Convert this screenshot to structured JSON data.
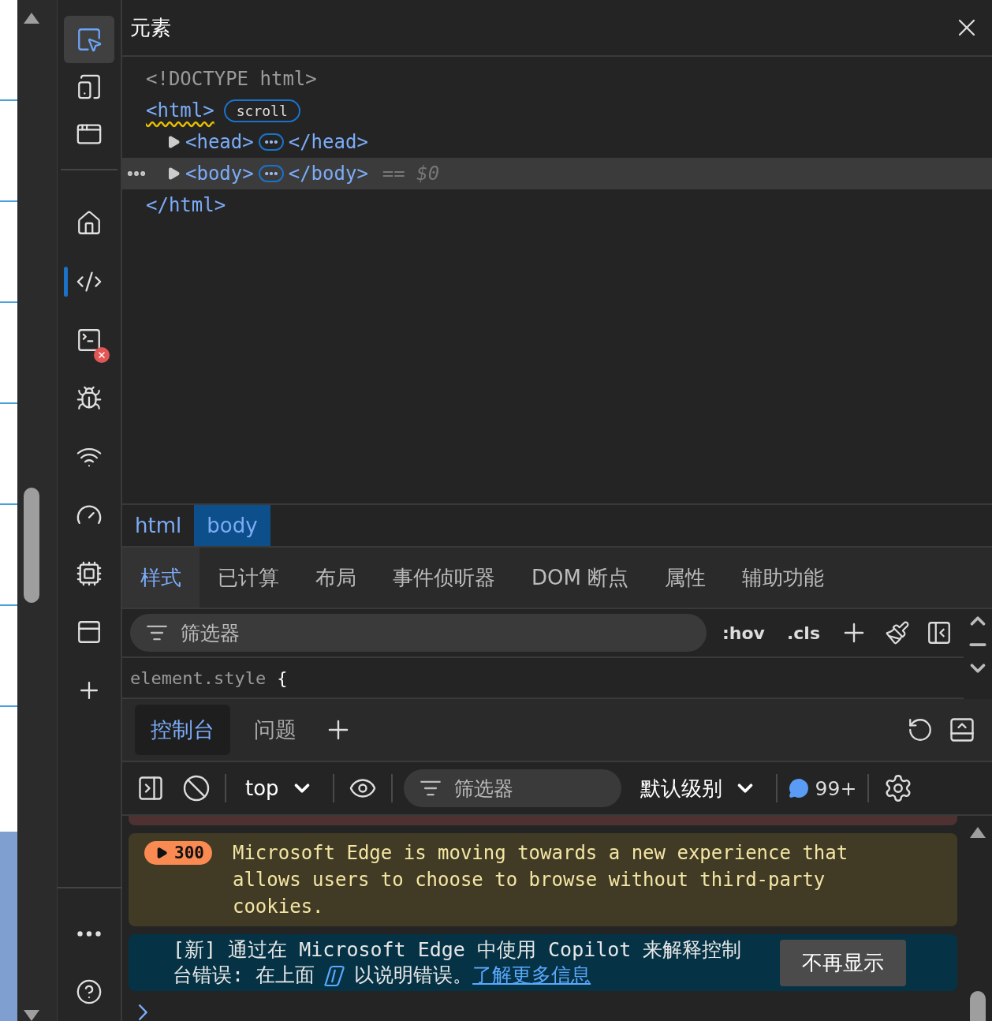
{
  "activity_bar": {
    "tools": [
      {
        "kind": "inspect",
        "selected": true
      },
      {
        "kind": "device",
        "selected": false
      },
      {
        "kind": "window",
        "selected": false
      }
    ],
    "panels": [
      {
        "kind": "home",
        "selected": false,
        "error": false
      },
      {
        "kind": "elements",
        "selected": true,
        "error": false
      },
      {
        "kind": "console",
        "selected": false,
        "error": true
      },
      {
        "kind": "sources",
        "selected": false,
        "error": false
      },
      {
        "kind": "network",
        "selected": false,
        "error": false
      },
      {
        "kind": "performance",
        "selected": false,
        "error": false
      },
      {
        "kind": "memory",
        "selected": false,
        "error": false
      },
      {
        "kind": "application",
        "selected": false,
        "error": false
      },
      {
        "kind": "add",
        "selected": false,
        "error": false
      }
    ],
    "footer": [
      {
        "kind": "more"
      },
      {
        "kind": "help"
      }
    ]
  },
  "window": {
    "title": "元素"
  },
  "dom_tree": [
    {
      "kind": "doctype",
      "text": "<!DOCTYPE html>"
    },
    {
      "kind": "element",
      "open": "<html>",
      "close": "</html>",
      "badge": "scroll",
      "warning": true,
      "expanded": true,
      "selected": false,
      "children": [
        {
          "kind": "element",
          "open": "<head>",
          "close": "</head>",
          "expanded": false,
          "selected": false,
          "warning": false
        },
        {
          "kind": "element",
          "open": "<body>",
          "close": "</body>",
          "expanded": false,
          "selected": true,
          "warning": false,
          "suffix": "== $0"
        }
      ]
    }
  ],
  "breadcrumbs": [
    {
      "label": "html",
      "selected": false
    },
    {
      "label": "body",
      "selected": true
    }
  ],
  "panel_tabs": [
    {
      "label": "样式",
      "selected": true
    },
    {
      "label": "已计算",
      "selected": false
    },
    {
      "label": "布局",
      "selected": false
    },
    {
      "label": "事件侦听器",
      "selected": false
    },
    {
      "label": "DOM 断点",
      "selected": false
    },
    {
      "label": "属性",
      "selected": false
    },
    {
      "label": "辅助功能",
      "selected": false
    }
  ],
  "styles_toolbar": {
    "filter_placeholder": "筛选器",
    "buttons": [
      ":hov",
      ".cls"
    ]
  },
  "style_rule": {
    "selector": "element.style",
    "brace": "{"
  },
  "drawer_tabs": [
    {
      "label": "控制台",
      "selected": true
    },
    {
      "label": "问题",
      "selected": false
    }
  ],
  "console_toolbar": {
    "context": "top",
    "filter_placeholder": "筛选器",
    "level": "默认级别",
    "count": "99+"
  },
  "messages": [
    {
      "kind": "issue",
      "count": "300",
      "text": "Microsoft Edge is moving towards a new experience that allows users to choose to browse without third-party cookies."
    },
    {
      "kind": "promo",
      "text_before": "[新] 通过在 Microsoft Edge 中使用 Copilot 来解释控制台错误: 在上面",
      "text_after": "以说明错误。",
      "link": "了解更多信息",
      "button": "不再显示"
    }
  ]
}
